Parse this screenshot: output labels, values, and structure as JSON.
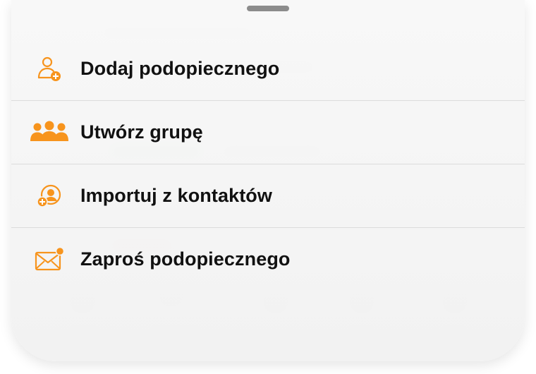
{
  "colors": {
    "accent": "#F7941D",
    "text": "#111111",
    "sheet_background": "#F4F4F4",
    "divider": "#DCDCDC",
    "grabber": "#8C8C8C"
  },
  "menu": {
    "items": [
      {
        "label": "Dodaj podopiecznego",
        "icon": "add-person-icon"
      },
      {
        "label": "Utwórz grupę",
        "icon": "group-icon"
      },
      {
        "label": "Importuj z kontaktów",
        "icon": "import-contact-icon"
      },
      {
        "label": "Zaproś podopiecznego",
        "icon": "envelope-notification-icon"
      }
    ]
  }
}
